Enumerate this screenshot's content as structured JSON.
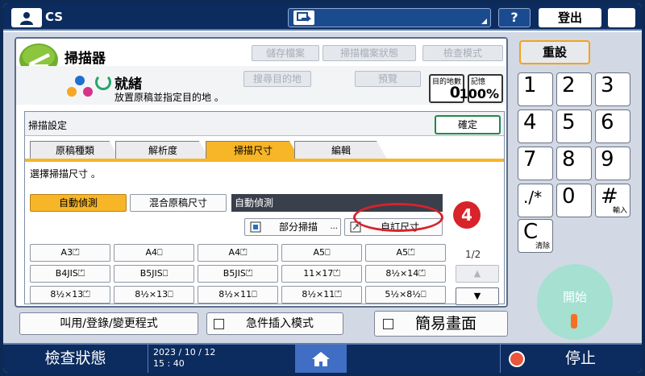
{
  "topbar": {
    "user_name": "CS",
    "help_label": "?",
    "logout_label": "登出"
  },
  "scanner": {
    "title": "掃描器",
    "header_buttons": [
      "儲存檔案",
      "掃描檔案狀態",
      "檢查模式"
    ],
    "dest_buttons": [
      "搜尋目的地",
      "預覽"
    ],
    "status": "就緒",
    "status_sub": "放置原稿並指定目的地 。",
    "counter_label": "目的地數",
    "counter_value": "0",
    "memory_label": "記憶",
    "memory_value": "100%"
  },
  "settings": {
    "title": "掃描設定",
    "ok_label": "確定",
    "tabs": [
      "原稿種類",
      "解析度",
      "掃描尺寸",
      "編輯"
    ],
    "active_tab": "掃描尺寸",
    "instruction": "選擇掃描尺寸 。",
    "auto_detect": "自動偵測",
    "mixed_sizes": "混合原稿尺寸",
    "size_display": "自動偵測",
    "partial_scan": "部分掃描",
    "custom_size": "自訂尺寸",
    "sizes": [
      [
        "A3⏍",
        "A4⎕",
        "A4⏍",
        "A5⎕",
        "A5⏍"
      ],
      [
        "B4JIS⏍",
        "B5JIS⎕",
        "B5JIS⏍",
        "11×17⏍",
        "8½×14⏍"
      ],
      [
        "8½×13⏍",
        "8½×13⎕",
        "8½×11⎕",
        "8½×11⏍",
        "5½×8½⎕"
      ]
    ],
    "page_indicator": "1/2",
    "scroll_up": "▲",
    "scroll_down": "▼"
  },
  "callout": {
    "number": "4"
  },
  "bottom_buttons": {
    "program": "叫用/登錄/變更程式",
    "interrupt": "急件插入模式",
    "simple": "簡易畫面"
  },
  "keypad": {
    "reset": "重設",
    "keys": [
      {
        "num": "1",
        "sub": ""
      },
      {
        "num": "2",
        "sub": ""
      },
      {
        "num": "3",
        "sub": ""
      },
      {
        "num": "4",
        "sub": ""
      },
      {
        "num": "5",
        "sub": ""
      },
      {
        "num": "6",
        "sub": ""
      },
      {
        "num": "7",
        "sub": ""
      },
      {
        "num": "8",
        "sub": ""
      },
      {
        "num": "9",
        "sub": ""
      },
      {
        "num": "./*",
        "sub": ""
      },
      {
        "num": "0",
        "sub": ""
      },
      {
        "num": "#",
        "sub": "輸入"
      },
      {
        "num": "C",
        "sub": "清除"
      }
    ],
    "start": "開始"
  },
  "bottombar": {
    "check_status": "檢查狀態",
    "date": "2023 / 10 / 12",
    "time": "15 : 40",
    "stop": "停止"
  },
  "colors": {
    "accent_yellow": "#f7b528",
    "navy": "#0c2b5e",
    "ok_green": "#1f8a4a",
    "callout_red": "#d8232a",
    "start_teal": "#a5e0d0"
  }
}
